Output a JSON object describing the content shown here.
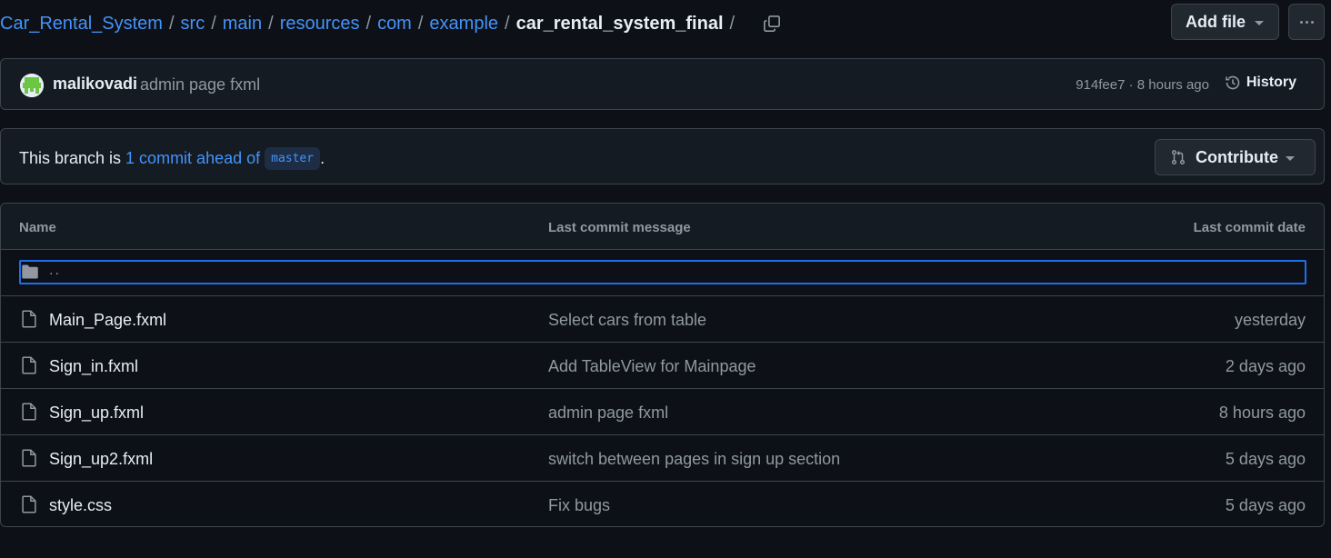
{
  "breadcrumb": {
    "items": [
      "Car_Rental_System",
      "src",
      "main",
      "resources",
      "com",
      "example"
    ],
    "current": "car_rental_system_final",
    "separator": "/"
  },
  "toolbar": {
    "add_file_label": "Add file",
    "more_icon": "kebab-horizontal-icon"
  },
  "latest_commit": {
    "author": "malikovadi",
    "message": "admin page fxml",
    "meta": "914fee7 · 8 hours ago",
    "history_label": "History"
  },
  "branch": {
    "prefix": "This branch is",
    "ahead_link": "1 commit ahead of",
    "base": "master",
    "suffix": ".",
    "contribute_label": "Contribute"
  },
  "table": {
    "headers": {
      "name": "Name",
      "message": "Last commit message",
      "date": "Last commit date"
    },
    "parent": "..",
    "rows": [
      {
        "name": "Main_Page.fxml",
        "message": "Select cars from table",
        "date": "yesterday"
      },
      {
        "name": "Sign_in.fxml",
        "message": "Add TableView for Mainpage",
        "date": "2 days ago"
      },
      {
        "name": "Sign_up.fxml",
        "message": "admin page fxml",
        "date": "8 hours ago"
      },
      {
        "name": "Sign_up2.fxml",
        "message": "switch between pages in sign up section",
        "date": "5 days ago"
      },
      {
        "name": "style.css",
        "message": "Fix bugs",
        "date": "5 days ago"
      }
    ]
  },
  "colors": {
    "background": "#0d1117",
    "link": "#4493f8",
    "border": "#3d444d",
    "focus": "#1f6feb"
  }
}
